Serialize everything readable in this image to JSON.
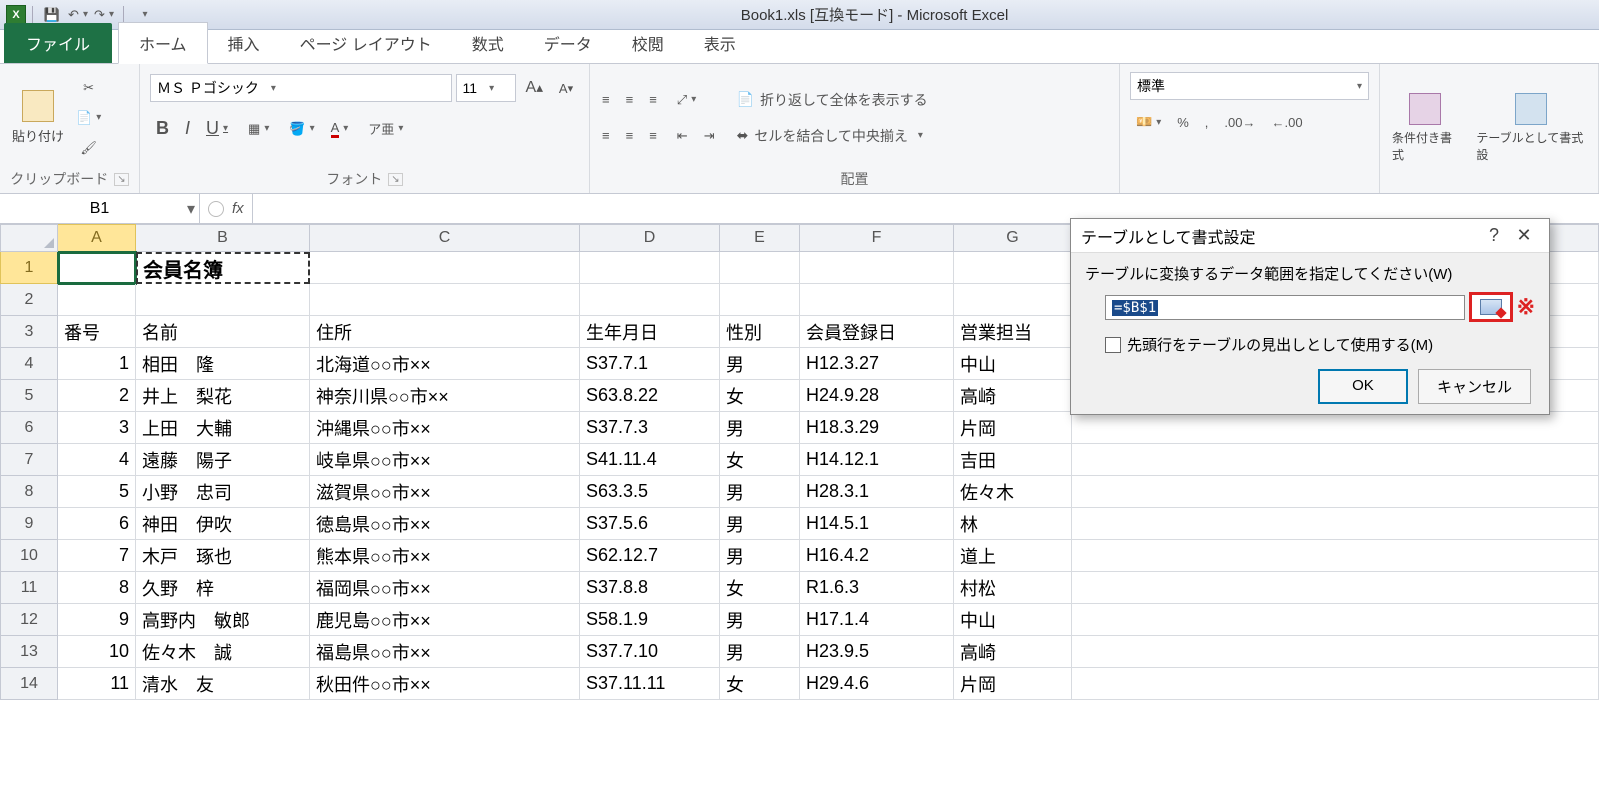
{
  "app": {
    "title": "Book1.xls  [互換モード] - Microsoft Excel"
  },
  "tabs": {
    "file": "ファイル",
    "home": "ホーム",
    "insert": "挿入",
    "page_layout": "ページ レイアウト",
    "formulas": "数式",
    "data": "データ",
    "review": "校閲",
    "view": "表示"
  },
  "ribbon": {
    "clipboard": {
      "label": "クリップボード",
      "paste": "貼り付け"
    },
    "font": {
      "label": "フォント",
      "name": "ＭＳ Ｐゴシック",
      "size": "11"
    },
    "alignment": {
      "label": "配置",
      "wrap": "折り返して全体を表示する",
      "merge": "セルを結合して中央揃え"
    },
    "number": {
      "label": "",
      "format": "標準"
    },
    "styles": {
      "cond": "条件付き書式",
      "table": "テーブルとして書式設"
    }
  },
  "formula_bar": {
    "name_box": "B1",
    "fx": "fx",
    "value": ""
  },
  "columns": [
    "A",
    "B",
    "C",
    "D",
    "E",
    "F",
    "G"
  ],
  "row_numbers": [
    "1",
    "2",
    "3",
    "4",
    "5",
    "6",
    "7",
    "8",
    "9",
    "10",
    "11",
    "12",
    "13",
    "14"
  ],
  "sheet": {
    "title_cell": "会員名簿",
    "headers": {
      "a": "番号",
      "b": "名前",
      "c": "住所",
      "d": "生年月日",
      "e": "性別",
      "f": "会員登録日",
      "g": "営業担当"
    },
    "rows": [
      {
        "no": "1",
        "name": "相田　隆",
        "addr": "北海道○○市××",
        "dob": "S37.7.1",
        "sex": "男",
        "reg": "H12.3.27",
        "rep": "中山"
      },
      {
        "no": "2",
        "name": "井上　梨花",
        "addr": "神奈川県○○市××",
        "dob": "S63.8.22",
        "sex": "女",
        "reg": "H24.9.28",
        "rep": "高崎"
      },
      {
        "no": "3",
        "name": "上田　大輔",
        "addr": "沖縄県○○市××",
        "dob": "S37.7.3",
        "sex": "男",
        "reg": "H18.3.29",
        "rep": "片岡"
      },
      {
        "no": "4",
        "name": "遠藤　陽子",
        "addr": "岐阜県○○市××",
        "dob": "S41.11.4",
        "sex": "女",
        "reg": "H14.12.1",
        "rep": "吉田"
      },
      {
        "no": "5",
        "name": "小野　忠司",
        "addr": "滋賀県○○市××",
        "dob": "S63.3.5",
        "sex": "男",
        "reg": "H28.3.1",
        "rep": "佐々木"
      },
      {
        "no": "6",
        "name": "神田　伊吹",
        "addr": "徳島県○○市××",
        "dob": "S37.5.6",
        "sex": "男",
        "reg": "H14.5.1",
        "rep": "林"
      },
      {
        "no": "7",
        "name": "木戸　琢也",
        "addr": "熊本県○○市××",
        "dob": "S62.12.7",
        "sex": "男",
        "reg": "H16.4.2",
        "rep": "道上"
      },
      {
        "no": "8",
        "name": "久野　梓",
        "addr": "福岡県○○市××",
        "dob": "S37.8.8",
        "sex": "女",
        "reg": "R1.6.3",
        "rep": "村松"
      },
      {
        "no": "9",
        "name": "高野内　敏郎",
        "addr": "鹿児島○○市××",
        "dob": "S58.1.9",
        "sex": "男",
        "reg": "H17.1.4",
        "rep": "中山"
      },
      {
        "no": "10",
        "name": "佐々木　誠",
        "addr": "福島県○○市××",
        "dob": "S37.7.10",
        "sex": "男",
        "reg": "H23.9.5",
        "rep": "高崎"
      },
      {
        "no": "11",
        "name": "清水　友",
        "addr": "秋田件○○市××",
        "dob": "S37.11.11",
        "sex": "女",
        "reg": "H29.4.6",
        "rep": "片岡"
      }
    ]
  },
  "dialog": {
    "title": "テーブルとして書式設定",
    "prompt": "テーブルに変換するデータ範囲を指定してください(W)",
    "range": "=$B$1",
    "header_chk": "先頭行をテーブルの見出しとして使用する(M)",
    "ok": "OK",
    "cancel": "キャンセル",
    "annotation": "※"
  }
}
